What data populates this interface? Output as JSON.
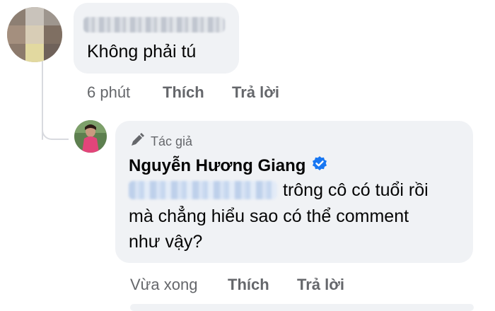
{
  "comment": {
    "text": "Không phải tú",
    "time": "6 phút",
    "like_label": "Thích",
    "reply_label": "Trả lời"
  },
  "reply": {
    "badge_label": "Tác giả",
    "author_name": "Nguyễn Hương Giang",
    "text_line1": "trông cô có tuổi rồi",
    "text_line2": "mà chẳng hiểu sao có thể comment",
    "text_line3": "như vậy?",
    "time": "Vừa xong",
    "like_label": "Thích",
    "reply_label": "Trả lời"
  },
  "colors": {
    "bubble": "#f0f2f5",
    "meta_text": "#65676b",
    "verified": "#1877f2"
  },
  "icons": {
    "badge": "pencil-icon",
    "verified": "verified-badge-icon"
  }
}
